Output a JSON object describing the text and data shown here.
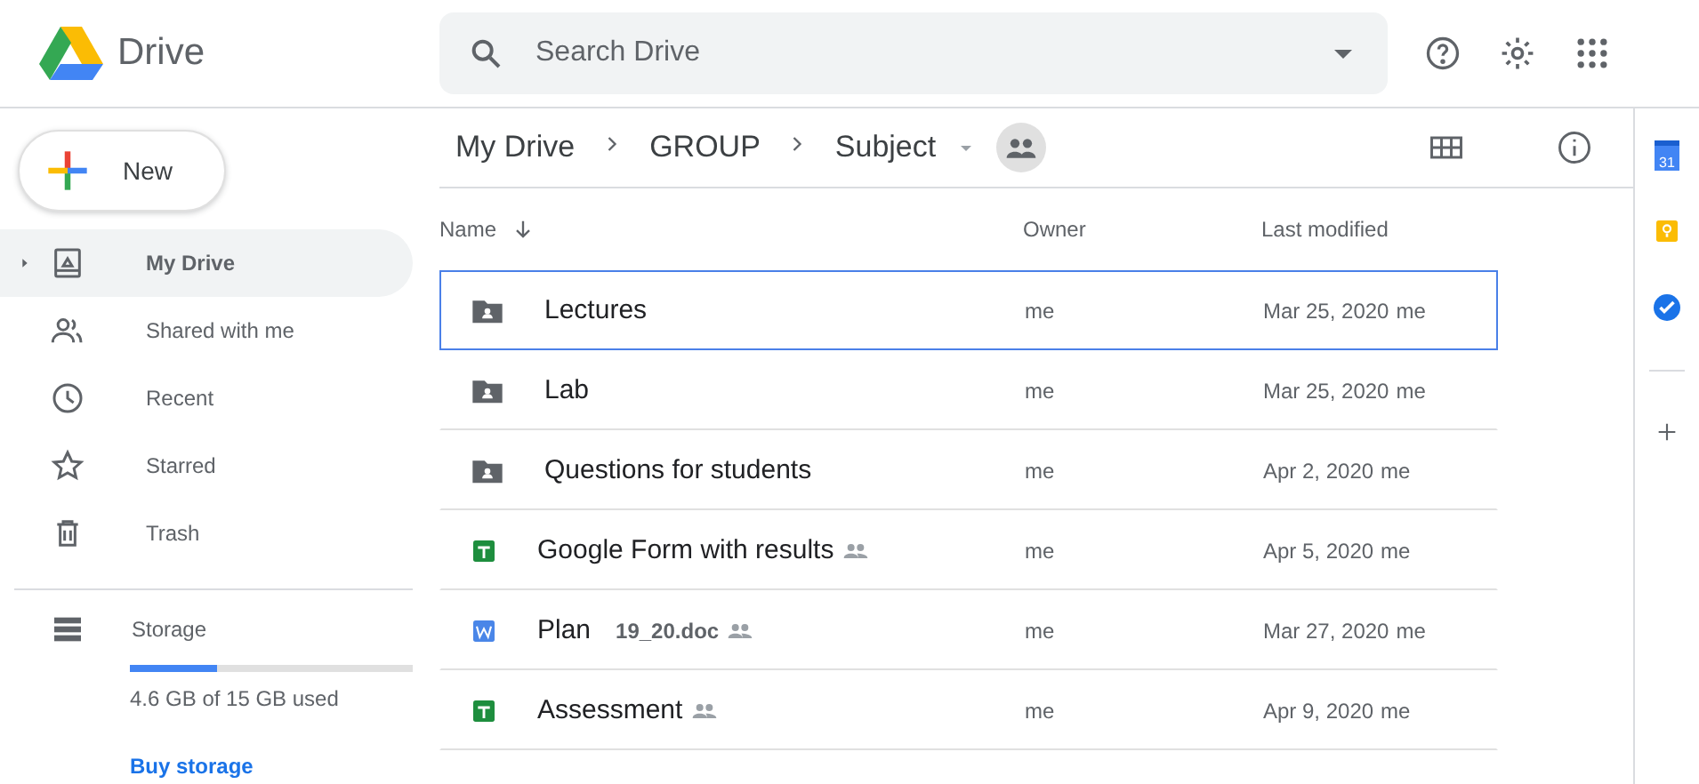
{
  "app": {
    "title": "Drive"
  },
  "search": {
    "placeholder": "Search Drive"
  },
  "new_button": "New",
  "sidebar": {
    "items": [
      {
        "label": "My Drive",
        "selected": true
      },
      {
        "label": "Shared with me",
        "selected": false
      },
      {
        "label": "Recent",
        "selected": false
      },
      {
        "label": "Starred",
        "selected": false
      },
      {
        "label": "Trash",
        "selected": false
      }
    ],
    "storage": {
      "label": "Storage",
      "level": 0.31,
      "usage": "4.6 GB of 15 GB used",
      "link": "Buy storage"
    }
  },
  "breadcrumb": [
    "My Drive",
    "GROUP",
    "Subject"
  ],
  "table": {
    "columns": [
      "Name",
      "Owner",
      "Last modified"
    ],
    "rows": [
      {
        "kind": "folder",
        "name": "Lectures",
        "shared": false,
        "owner": "me",
        "modified": "Mar 25, 2020",
        "modified_by": "me",
        "selected": true
      },
      {
        "kind": "folder",
        "name": "Lab",
        "shared": false,
        "owner": "me",
        "modified": "Mar 25, 2020",
        "modified_by": "me",
        "selected": false
      },
      {
        "kind": "folder",
        "name": "Questions for students",
        "shared": false,
        "owner": "me",
        "modified": "Apr 2, 2020",
        "modified_by": "me",
        "selected": false
      },
      {
        "kind": "sheet",
        "name": "Google Form with results",
        "shared": true,
        "owner": "me",
        "modified": "Apr 5, 2020",
        "modified_by": "me",
        "selected": false
      },
      {
        "kind": "doc",
        "name": "Plan",
        "extra": "19_20.doc",
        "shared": true,
        "owner": "me",
        "modified": "Mar 27, 2020",
        "modified_by": "me",
        "selected": false
      },
      {
        "kind": "sheet",
        "name": "Assessment",
        "shared": true,
        "owner": "me",
        "modified": "Apr 9, 2020",
        "modified_by": "me",
        "selected": false
      }
    ]
  },
  "side_panel": {
    "calendar_day": "31"
  }
}
